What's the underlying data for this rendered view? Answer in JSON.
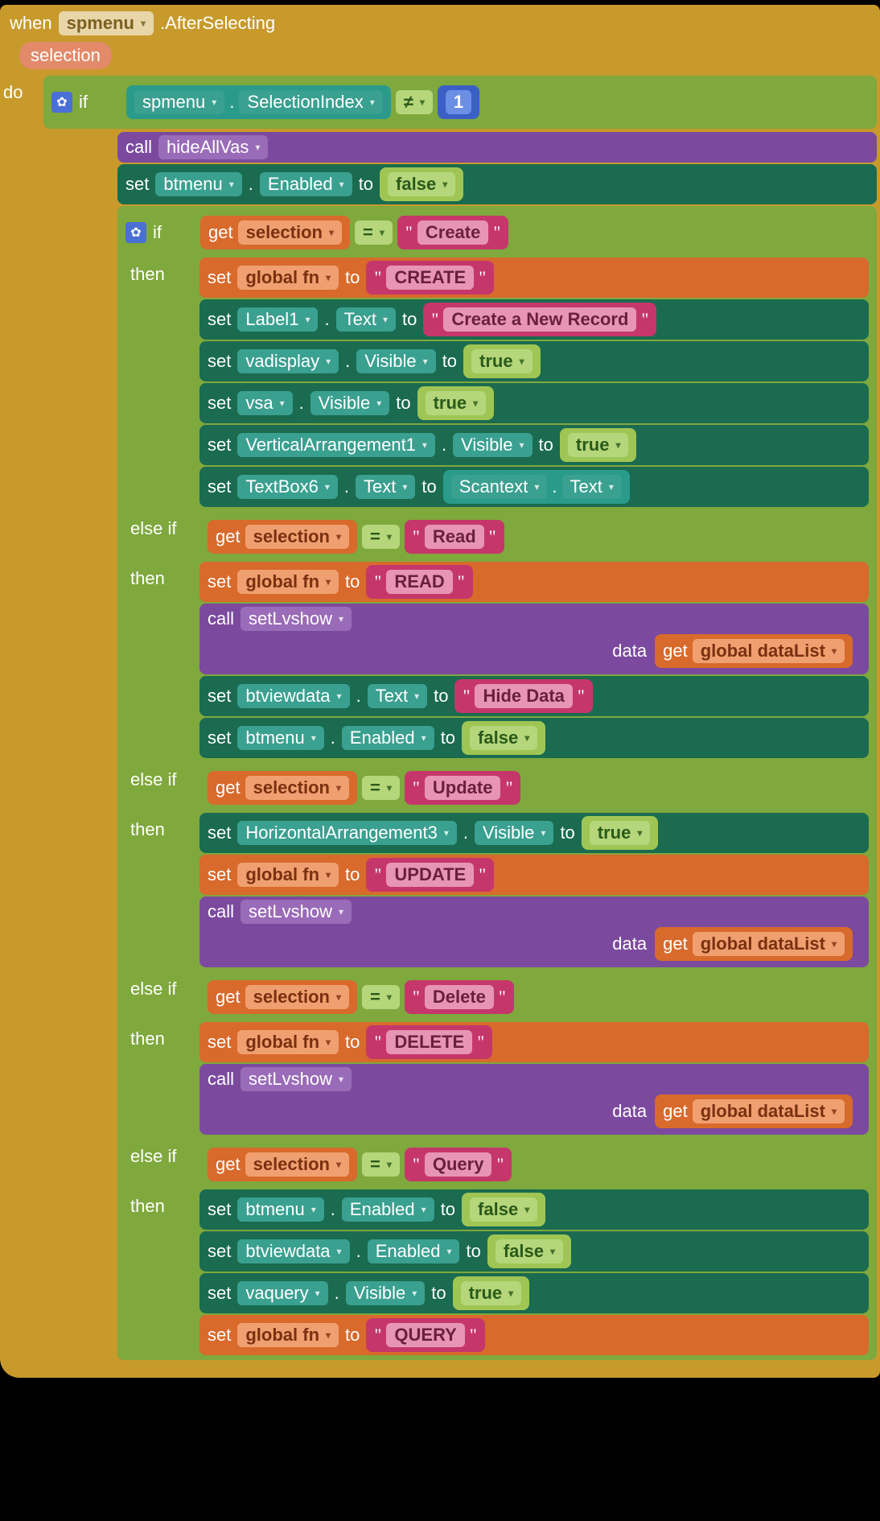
{
  "event": {
    "when": "when",
    "component": "spmenu",
    "method": ".AfterSelecting",
    "param": "selection",
    "do": "do"
  },
  "if": {
    "kw": "if",
    "then": "then",
    "elseif": "else if"
  },
  "cond0": {
    "comp": "spmenu",
    "prop": "SelectionIndex",
    "op": "≠",
    "val": "1"
  },
  "call_hide": {
    "kw": "call",
    "proc": "hideAllVas"
  },
  "set_btmenu_false": {
    "kw": "set",
    "comp": "btmenu",
    "prop": "Enabled",
    "to": "to",
    "val": "false"
  },
  "ops": {
    "eq": "=",
    "get": "get",
    "set": "set",
    "to": "to",
    "call": "call",
    "data": "data"
  },
  "sel_var": "selection",
  "branch_create": {
    "match": "Create",
    "fn": {
      "var": "global fn",
      "val": "CREATE"
    },
    "label1": {
      "comp": "Label1",
      "prop": "Text",
      "val": "Create a New Record"
    },
    "vadisplay": {
      "comp": "vadisplay",
      "prop": "Visible",
      "val": "true"
    },
    "vsa": {
      "comp": "vsa",
      "prop": "Visible",
      "val": "true"
    },
    "va1": {
      "comp": "VerticalArrangement1",
      "prop": "Visible",
      "val": "true"
    },
    "tb6": {
      "comp": "TextBox6",
      "prop": "Text",
      "src_comp": "Scantext",
      "src_prop": "Text"
    }
  },
  "branch_read": {
    "match": "Read",
    "fn": {
      "var": "global fn",
      "val": "READ"
    },
    "call": {
      "proc": "setLvshow",
      "arg_var": "global dataList"
    },
    "btview": {
      "comp": "btviewdata",
      "prop": "Text",
      "val": "Hide Data"
    },
    "btmenu": {
      "comp": "btmenu",
      "prop": "Enabled",
      "val": "false"
    }
  },
  "branch_update": {
    "match": "Update",
    "ha3": {
      "comp": "HorizontalArrangement3",
      "prop": "Visible",
      "val": "true"
    },
    "fn": {
      "var": "global fn",
      "val": "UPDATE"
    },
    "call": {
      "proc": "setLvshow",
      "arg_var": "global dataList"
    }
  },
  "branch_delete": {
    "match": "Delete",
    "fn": {
      "var": "global fn",
      "val": "DELETE"
    },
    "call": {
      "proc": "setLvshow",
      "arg_var": "global dataList"
    }
  },
  "branch_query": {
    "match": "Query",
    "btmenu": {
      "comp": "btmenu",
      "prop": "Enabled",
      "val": "false"
    },
    "btview": {
      "comp": "btviewdata",
      "prop": "Enabled",
      "val": "false"
    },
    "vaquery": {
      "comp": "vaquery",
      "prop": "Visible",
      "val": "true"
    },
    "fn": {
      "var": "global fn",
      "val": "QUERY"
    }
  }
}
